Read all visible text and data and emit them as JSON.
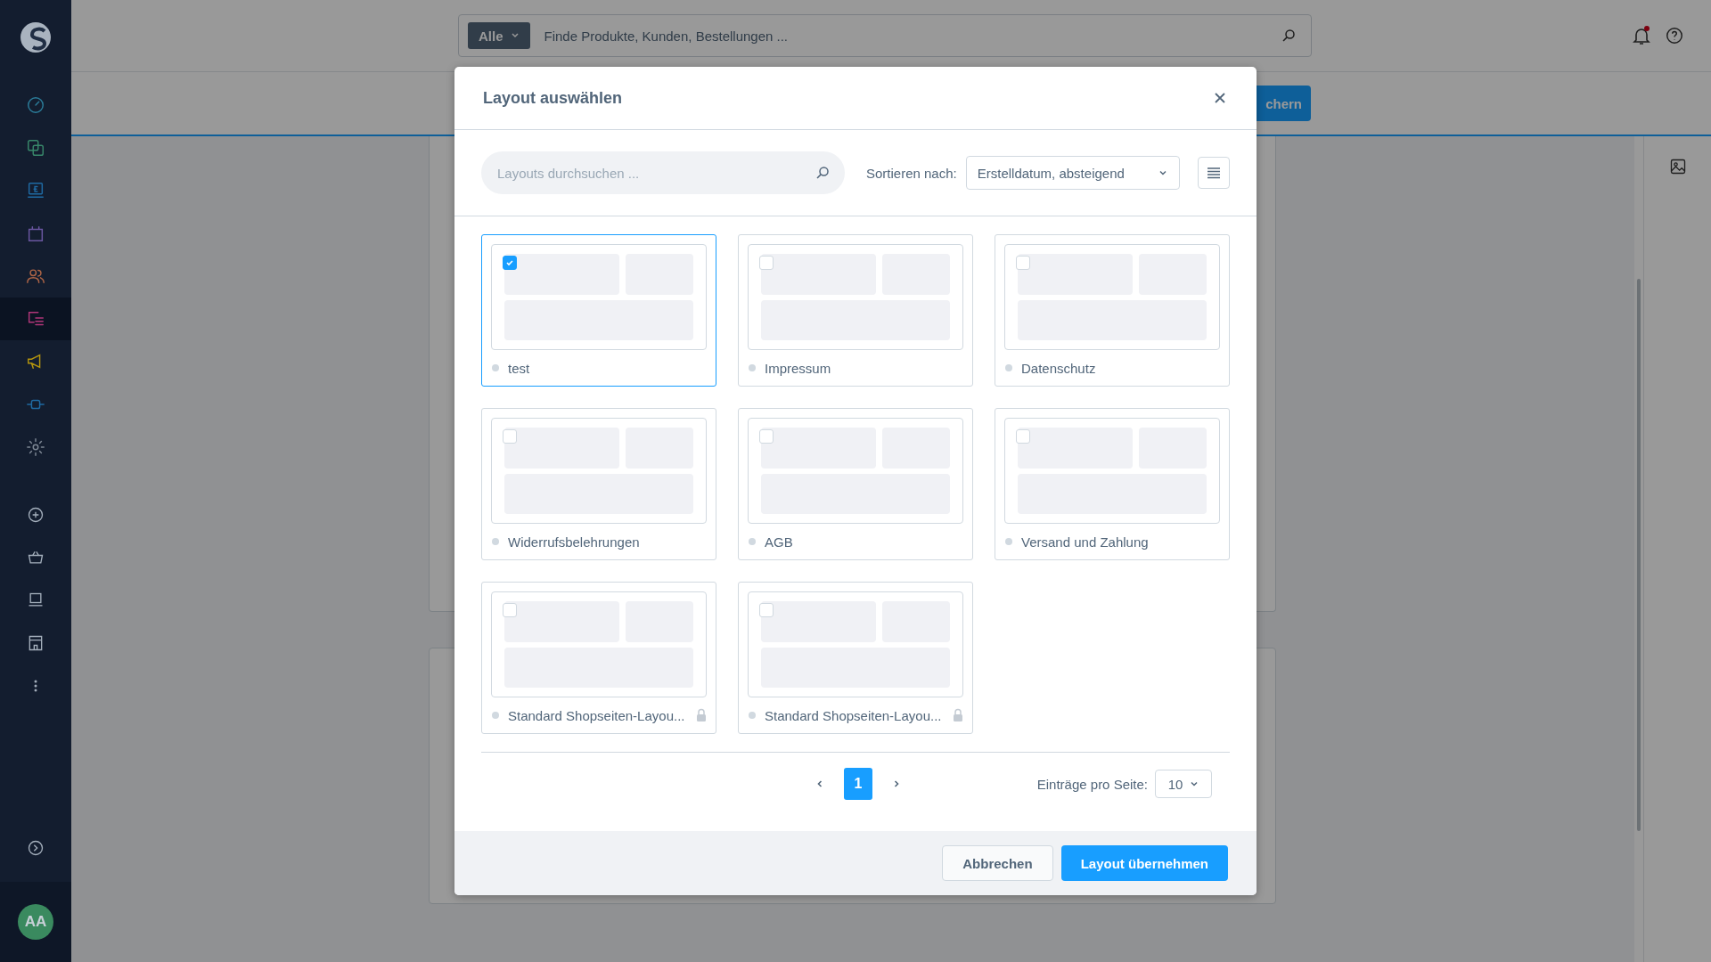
{
  "sidebar": {
    "items": [
      {
        "kind": "dashboard",
        "color": "#2b7c99",
        "selected": false
      },
      {
        "kind": "catalog",
        "color": "#38876a",
        "selected": false
      },
      {
        "kind": "orders",
        "color": "#1f6aa3",
        "selected": false
      },
      {
        "kind": "bag",
        "color": "#6a56a0",
        "selected": false
      },
      {
        "kind": "customers",
        "color": "#ad6446",
        "selected": false
      },
      {
        "kind": "content",
        "color": "#b03679",
        "selected": true
      },
      {
        "kind": "marketing",
        "color": "#b3940e",
        "selected": false
      },
      {
        "kind": "extensions",
        "color": "#1f6aa3",
        "selected": false
      },
      {
        "kind": "settings",
        "color": "#7d8794",
        "selected": false
      }
    ],
    "channels": [
      {
        "kind": "add"
      },
      {
        "kind": "basket"
      },
      {
        "kind": "pos"
      },
      {
        "kind": "store"
      },
      {
        "kind": "more"
      }
    ],
    "avatar": "AA"
  },
  "topbar": {
    "scope": "Alle",
    "placeholder": "Finde Produkte, Kunden, Bestellungen ...",
    "notification": true
  },
  "smartbar": {
    "save_button": "chern"
  },
  "modal": {
    "title": "Layout auswählen",
    "search": {
      "placeholder": "Layouts durchsuchen ..."
    },
    "sort": {
      "label": "Sortieren nach:",
      "value": "Erstelldatum, absteigend"
    },
    "layouts": [
      {
        "name": "test",
        "selected": true,
        "locked": false
      },
      {
        "name": "Impressum",
        "selected": false,
        "locked": false
      },
      {
        "name": "Datenschutz",
        "selected": false,
        "locked": false
      },
      {
        "name": "Widerrufsbelehrungen",
        "selected": false,
        "locked": false
      },
      {
        "name": "AGB",
        "selected": false,
        "locked": false
      },
      {
        "name": "Versand und Zahlung",
        "selected": false,
        "locked": false
      },
      {
        "name": "Standard Shopseiten-Layou...",
        "selected": false,
        "locked": true
      },
      {
        "name": "Standard Shopseiten-Layou...",
        "selected": false,
        "locked": true
      }
    ],
    "pagination": {
      "pages": [
        {
          "label": "1",
          "selected": true
        }
      ],
      "per_page_label": "Einträge pro Seite:",
      "per_page": "10"
    },
    "buttons": [
      {
        "label": "Abbrechen",
        "kind": "secondary"
      },
      {
        "label": "Layout übernehmen",
        "kind": "primary"
      }
    ]
  }
}
